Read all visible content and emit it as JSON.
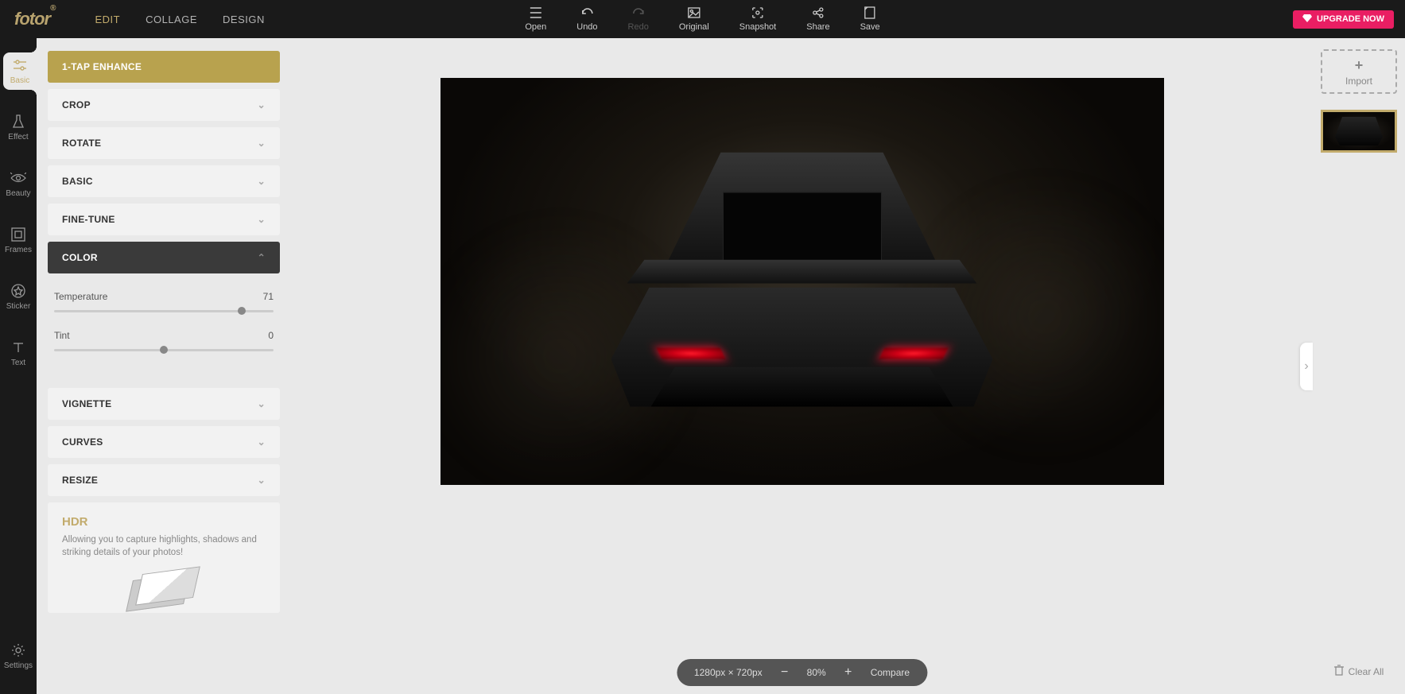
{
  "brand": "fotor",
  "nav": {
    "edit": "EDIT",
    "collage": "COLLAGE",
    "design": "DESIGN"
  },
  "tools": {
    "open": "Open",
    "undo": "Undo",
    "redo": "Redo",
    "original": "Original",
    "snapshot": "Snapshot",
    "share": "Share",
    "save": "Save"
  },
  "upgrade": "UPGRADE NOW",
  "rail": {
    "basic": "Basic",
    "effect": "Effect",
    "beauty": "Beauty",
    "frames": "Frames",
    "sticker": "Sticker",
    "text": "Text",
    "settings": "Settings"
  },
  "panel": {
    "enhance": "1-TAP ENHANCE",
    "crop": "CROP",
    "rotate": "ROTATE",
    "basic": "BASIC",
    "finetune": "FINE-TUNE",
    "color": "COLOR",
    "vignette": "VIGNETTE",
    "curves": "CURVES",
    "resize": "RESIZE"
  },
  "color": {
    "temperature_label": "Temperature",
    "temperature_value": "71",
    "tint_label": "Tint",
    "tint_value": "0"
  },
  "hdr": {
    "title": "HDR",
    "desc": "Allowing you to capture highlights, shadows and striking details of your photos!"
  },
  "zoom": {
    "dims": "1280px × 720px",
    "pct": "80%",
    "compare": "Compare"
  },
  "right": {
    "import": "Import",
    "clear": "Clear All"
  }
}
